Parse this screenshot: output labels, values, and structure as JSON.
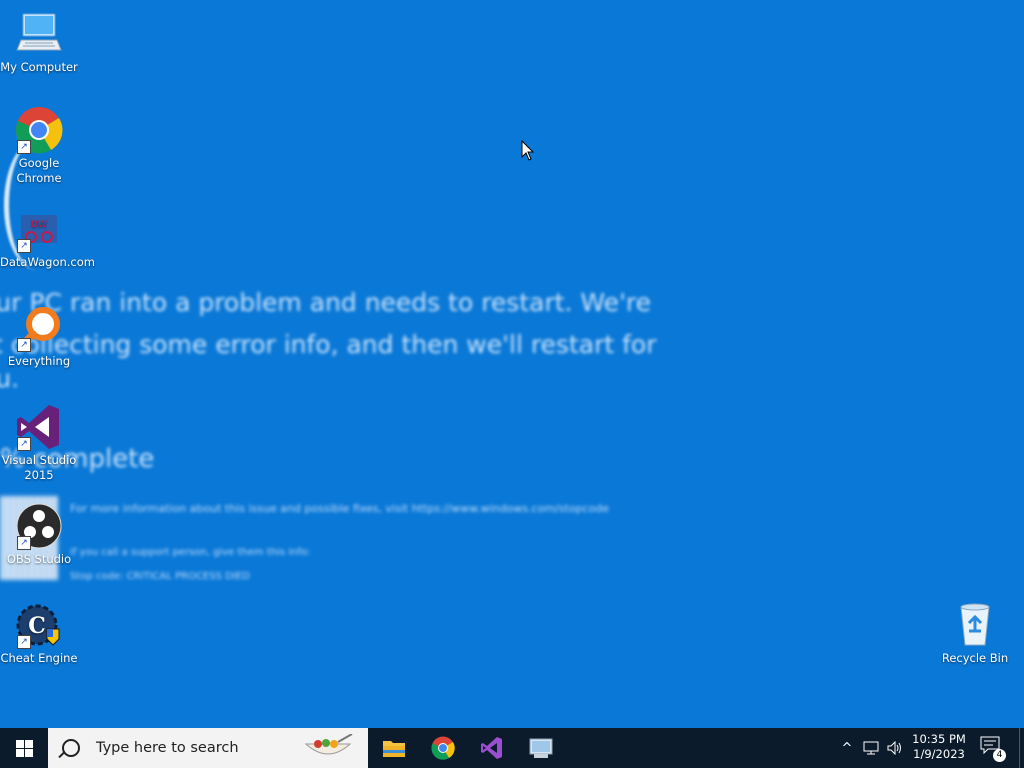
{
  "desktop": {
    "bsod": {
      "line1": "our PC ran into a problem and needs to restart. We're",
      "line2": "st collecting some error info, and then we'll restart for",
      "line3": "ou.",
      "progress": "% complete",
      "info": "For more information about this issue and possible fixes, visit https://www.windows.com/stopcode",
      "support1": "If you call a support person, give them this info:",
      "support2": "Stop code: CRITICAL PROCESS DIED"
    },
    "icons": [
      {
        "label": "My Computer"
      },
      {
        "label": "Google Chrome"
      },
      {
        "label": "DataWagon.com"
      },
      {
        "label": "Everything"
      },
      {
        "label": "Visual Studio 2015"
      },
      {
        "label": "OBS Studio"
      },
      {
        "label": "Cheat Engine"
      },
      {
        "label": "Recycle Bin"
      }
    ]
  },
  "taskbar": {
    "search_placeholder": "Type here to search",
    "pinned": [
      "File Explorer",
      "Google Chrome",
      "Visual Studio 2015",
      "Control Panel"
    ],
    "clock_time": "10:35 PM",
    "clock_date": "1/9/2023",
    "notification_count": "4"
  }
}
